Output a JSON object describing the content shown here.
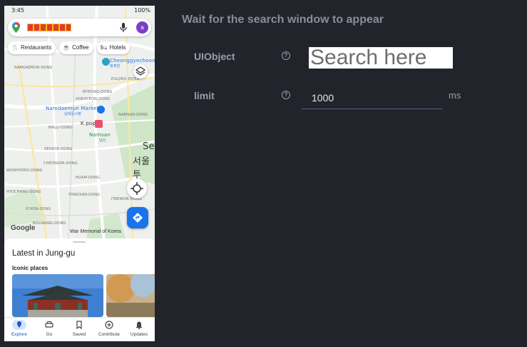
{
  "phone": {
    "status": {
      "time": "3:45",
      "battery": "100%"
    },
    "search": {
      "avatar_letter": "a"
    },
    "chips": [
      {
        "icon": "fork-knife-icon",
        "label": "Restaurants"
      },
      {
        "icon": "coffee-icon",
        "label": "Coffee"
      },
      {
        "icon": "hotel-bed-icon",
        "label": "Hotels"
      }
    ],
    "map_labels": {
      "cheonggyecheon": "Cheonggyecheon",
      "cheonggyecheon_ko": "청계천",
      "namdaemun": "Namdaemun Market",
      "namdaemun_ko": "남대문시장",
      "kpop": "K pop",
      "namsan": "Namsan",
      "namsan_ko": "남산",
      "seoul_1": "Se",
      "seoul_2": "서울투",
      "namdaemun_dong": "NAMDAEMUN-DONG",
      "euljiro": "EULJIRO-DONG",
      "myeongdong": "MYEONG-DONG",
      "hoehyeon": "HOEHYEON-DONG",
      "namsan_dong": "NAMSAN-DONG",
      "malli": "MALLI-DONG",
      "seogye": "SEOGYE-DONG",
      "cheongpa": "CHEONGPA-DONG",
      "yongsan": "YONGSAN-DONG",
      "ichon": "ICHON-DONG",
      "itaewon": "ITAEWON-DONG",
      "hyochang": "HYOCHANG-DONG",
      "wonhyoro": "WONHYORO-DONG",
      "huam": "HUAM-DONG",
      "bogwang": "BOGWANG-DONG"
    },
    "google_logo": "Google",
    "war_memorial": "War Memorial of Korea",
    "sheet": {
      "title": "Latest in Jung-gu",
      "subtitle": "Iconic places"
    },
    "nav": [
      {
        "label": "Explore",
        "icon": "explore-pin-icon",
        "active": true
      },
      {
        "label": "Go",
        "icon": "car-icon",
        "active": false
      },
      {
        "label": "Saved",
        "icon": "bookmark-icon",
        "active": false
      },
      {
        "label": "Contribute",
        "icon": "plus-circle-icon",
        "active": false
      },
      {
        "label": "Updates",
        "icon": "bell-icon",
        "active": false
      }
    ]
  },
  "panel": {
    "heading": "Wait for the search window to appear",
    "fields": [
      {
        "label": "UIObject",
        "value": "Search here"
      },
      {
        "label": "limit",
        "value": "1000",
        "unit": "ms"
      }
    ]
  },
  "colors": {
    "background": "#22242c",
    "accent": "#1a73e8",
    "text_muted": "#9a9da5"
  }
}
